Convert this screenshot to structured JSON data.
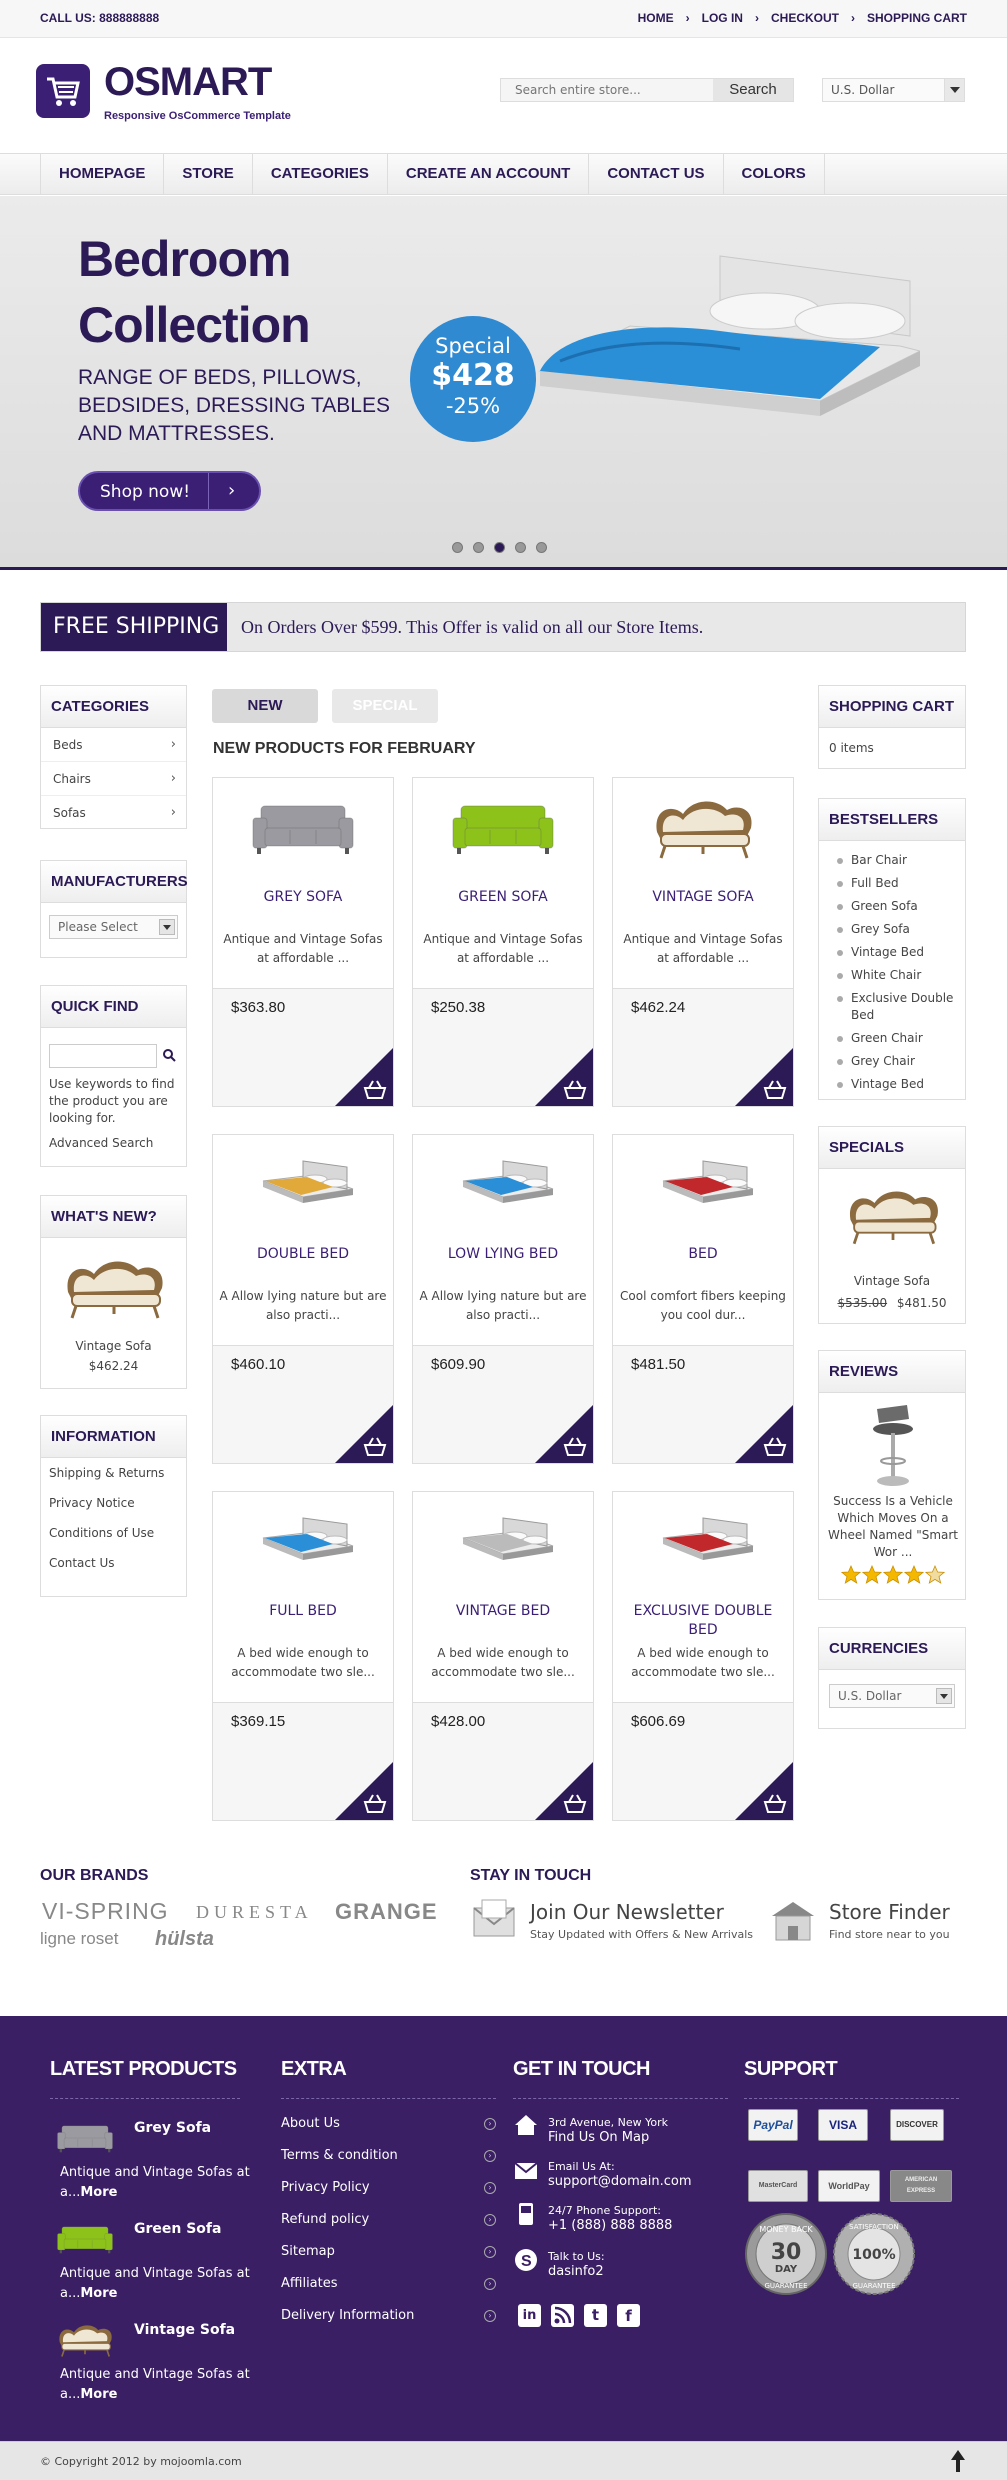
{
  "topbar": {
    "call": "CALL US: 888888888",
    "links": [
      "HOME",
      "LOG IN",
      "CHECKOUT",
      "SHOPPING CART"
    ]
  },
  "header": {
    "logo_name": "OSMART",
    "logo_tagline": "Responsive OsCommerce Template",
    "search_placeholder": "Search entire store...",
    "search_button": "Search",
    "currency": "U.S. Dollar"
  },
  "nav": [
    "HOMEPAGE",
    "STORE",
    "CATEGORIES",
    "CREATE AN ACCOUNT",
    "CONTACT US",
    "COLORS"
  ],
  "hero": {
    "title_line1": "Bedroom",
    "title_line2": "Collection",
    "subtitle": "RANGE OF BEDS, PILLOWS, BEDSIDES, DRESSING TABLES AND MATTRESSES.",
    "button": "Shop now!",
    "badge_label": "Special",
    "badge_price": "$428",
    "badge_discount": "-25%",
    "slides": 5,
    "active_slide": 3
  },
  "free_shipping": {
    "label": "FREE SHIPPING",
    "text": "On Orders Over $599. This Offer is valid on all our Store Items."
  },
  "left": {
    "categories": {
      "title": "CATEGORIES",
      "items": [
        "Beds",
        "Chairs",
        "Sofas"
      ]
    },
    "manufacturers": {
      "title": "MANUFACTURERS",
      "select": "Please Select"
    },
    "quick_find": {
      "title": "QUICK FIND",
      "hint": "Use keywords to find the product you are looking for.",
      "advanced": "Advanced Search"
    },
    "whats_new": {
      "title": "WHAT'S NEW?",
      "name": "Vintage Sofa",
      "price": "$462.24"
    },
    "information": {
      "title": "INFORMATION",
      "items": [
        "Shipping & Returns",
        "Privacy Notice",
        "Conditions of Use",
        "Contact Us"
      ]
    }
  },
  "center": {
    "tabs": [
      "NEW",
      "SPECIAL"
    ],
    "title": "NEW PRODUCTS FOR FEBRUARY",
    "products": [
      {
        "name": "GREY SOFA",
        "desc": "Antique and Vintage Sofas at affordable ...",
        "price": "$363.80",
        "kind": "sofa",
        "color": "#9a9aa0"
      },
      {
        "name": "GREEN SOFA",
        "desc": "Antique and Vintage Sofas at affordable ...",
        "price": "$250.38",
        "kind": "sofa",
        "color": "#8cc21a"
      },
      {
        "name": "VINTAGE SOFA",
        "desc": "Antique and Vintage Sofas at affordable ...",
        "price": "$462.24",
        "kind": "vintage",
        "color": "#efe6d4"
      },
      {
        "name": "DOUBLE BED",
        "desc": "A Allow lying nature but are also practi...",
        "price": "$460.10",
        "kind": "bed",
        "color": "#e1a83a"
      },
      {
        "name": "LOW LYING BED",
        "desc": "A Allow lying nature but are also practi...",
        "price": "$609.90",
        "kind": "bed",
        "color": "#2a8fd6"
      },
      {
        "name": "BED",
        "desc": "Cool comfort fibers keeping you cool dur...",
        "price": "$481.50",
        "kind": "bed",
        "color": "#c0282c"
      },
      {
        "name": "FULL BED",
        "desc": "A bed wide enough to accommodate two sle...",
        "price": "$369.15",
        "kind": "bed",
        "color": "#2a8fd6"
      },
      {
        "name": "VINTAGE BED",
        "desc": "A bed wide enough to accommodate two sle...",
        "price": "$428.00",
        "kind": "bed",
        "color": "#bbbbbb"
      },
      {
        "name": "EXCLUSIVE DOUBLE BED",
        "desc": "A bed wide enough to accommodate two sle...",
        "price": "$606.69",
        "kind": "bed",
        "color": "#c0282c"
      }
    ]
  },
  "right": {
    "cart": {
      "title": "SHOPPING CART",
      "items": "0 items"
    },
    "bestsellers": {
      "title": "BESTSELLERS",
      "items": [
        "Bar Chair",
        "Full Bed",
        "Green Sofa",
        "Grey Sofa",
        "Vintage Bed",
        "White Chair",
        "Exclusive Double Bed",
        "Green Chair",
        "Grey Chair",
        "Vintage Bed"
      ]
    },
    "specials": {
      "title": "SPECIALS",
      "name": "Vintage Sofa",
      "old_price": "$535.00",
      "price": "$481.50"
    },
    "reviews": {
      "title": "REVIEWS",
      "text": "Success Is a Vehicle Which Moves On a Wheel Named \"Smart Wor ...",
      "stars": 4
    },
    "currencies": {
      "title": "CURRENCIES",
      "select": "U.S. Dollar"
    }
  },
  "brands": {
    "title": "OUR BRANDS",
    "items": [
      "VI-SPRING",
      "DURESTA",
      "GRANGE",
      "ligne roset",
      "hülsta"
    ]
  },
  "stay": {
    "title": "STAY IN TOUCH",
    "newsletter_title": "Join Our Newsletter",
    "newsletter_sub": "Stay Updated with Offers & New Arrivals",
    "finder_title": "Store Finder",
    "finder_sub": "Find store near to you"
  },
  "footer": {
    "latest_title": "LATEST PRODUCTS",
    "latest": [
      {
        "name": "Grey Sofa",
        "desc": "Antique and Vintage Sofas at a...",
        "more": "More",
        "color": "#9a9aa0",
        "kind": "sofa"
      },
      {
        "name": "Green Sofa",
        "desc": "Antique and Vintage Sofas at a...",
        "more": "More",
        "color": "#8cc21a",
        "kind": "sofa"
      },
      {
        "name": "Vintage Sofa",
        "desc": "Antique and Vintage Sofas at a...",
        "more": "More",
        "color": "#efe6d4",
        "kind": "vintage"
      }
    ],
    "extra_title": "EXTRA",
    "extra": [
      "About Us",
      "Terms & condition",
      "Privacy Policy",
      "Refund policy",
      "Sitemap",
      "Affiliates",
      "Delivery Information"
    ],
    "git_title": "GET IN TOUCH",
    "address1": "3rd Avenue, New York",
    "address2": "Find Us On Map",
    "email_label": "Email Us At:",
    "email": "support@domain.com",
    "phone_label": "24/7 Phone Support:",
    "phone": "+1 (888) 888 8888",
    "talk_label": "Talk to Us:",
    "skype": "dasinfo2",
    "social": [
      "in",
      "rss",
      "t",
      "f"
    ],
    "support_title": "SUPPORT",
    "payments": [
      "PayPal",
      "VISA",
      "DISCOVER",
      "MasterCard",
      "WorldPay",
      "AMERICAN EXPRESS"
    ],
    "seal1": [
      "MONEY BACK",
      "30",
      "DAY",
      "GUARANTEE"
    ],
    "seal2": [
      "SATISFACTION",
      "100%",
      "GUARANTEE"
    ]
  },
  "copyright": "© Copyright 2012 by mojoomla.com",
  "colors": {
    "brand": "#2b1a55",
    "footer": "#3a1f64",
    "special": "#2f8ad1"
  }
}
